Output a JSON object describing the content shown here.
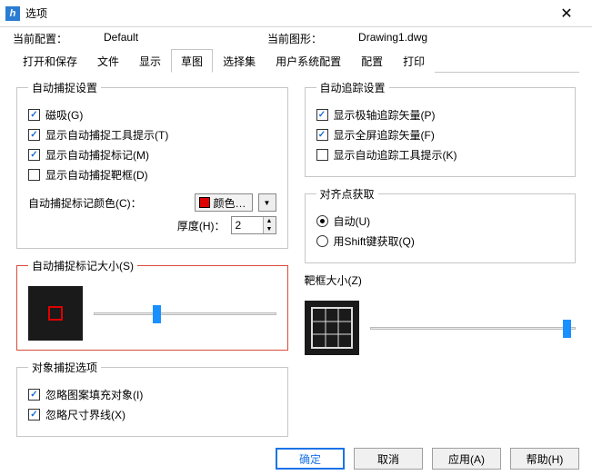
{
  "window": {
    "title": "选项"
  },
  "header": {
    "curConfigLabel": "当前配置：",
    "curConfigValue": "Default",
    "curDrawingLabel": "当前图形：",
    "curDrawingValue": "Drawing1.dwg"
  },
  "tabs": {
    "openSave": "打开和保存",
    "file": "文件",
    "display": "显示",
    "draft": "草图",
    "selection": "选择集",
    "userSys": "用户系统配置",
    "config": "配置",
    "print": "打印"
  },
  "autoSnap": {
    "legend": "自动捕捉设置",
    "magnet": "磁吸(G)",
    "tooltip": "显示自动捕捉工具提示(T)",
    "marker": "显示自动捕捉标记(M)",
    "aperture": "显示自动捕捉靶框(D)",
    "colorLabel": "自动捕捉标记颜色(C)：",
    "colorBtn": "颜色…",
    "thicknessLabel": "厚度(H)：",
    "thicknessValue": "2"
  },
  "autoTrack": {
    "legend": "自动追踪设置",
    "polar": "显示极轴追踪矢量(P)",
    "fullscreen": "显示全屏追踪矢量(F)",
    "tooltip": "显示自动追踪工具提示(K)"
  },
  "alignPoint": {
    "legend": "对齐点获取",
    "auto": "自动(U)",
    "shift": "用Shift键获取(Q)"
  },
  "markerSize": {
    "legend": "自动捕捉标记大小(S)"
  },
  "apertureSize": {
    "legend": "靶框大小(Z)"
  },
  "osnapOptions": {
    "legend": "对象捕捉选项",
    "ignoreHatch": "忽略图案填充对象(I)",
    "ignoreDim": "忽略尺寸界线(X)"
  },
  "footer": {
    "ok": "确定",
    "cancel": "取消",
    "apply": "应用(A)",
    "help": "帮助(H)"
  }
}
